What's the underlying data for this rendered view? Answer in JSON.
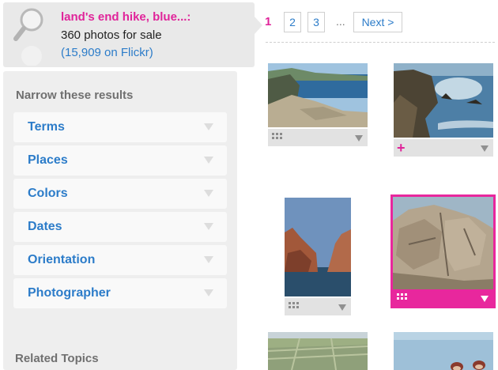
{
  "search": {
    "query": "land's end hike, blue...:",
    "count": "360 photos for sale",
    "flickr": "(15,909 on Flickr)"
  },
  "narrow": {
    "title": "Narrow these results",
    "filters": [
      {
        "label": "Terms"
      },
      {
        "label": "Places"
      },
      {
        "label": "Colors"
      },
      {
        "label": "Dates"
      },
      {
        "label": "Orientation"
      },
      {
        "label": "Photographer"
      }
    ],
    "related_title": "Related Topics"
  },
  "pagination": {
    "current": "1",
    "pages": [
      "2",
      "3"
    ],
    "ellipsis": "...",
    "next": "Next >"
  },
  "photos": [
    {
      "name": "coastal cliffs with rocky beach",
      "action_icon": "grid-icon"
    },
    {
      "name": "sunlit sea with rock islands",
      "action_icon": "plus-icon"
    },
    {
      "name": "sea cliffs portrait",
      "action_icon": "grid-icon"
    },
    {
      "name": "granite rock formation",
      "action_icon": "grid-icon",
      "selected": true
    },
    {
      "name": "green fields and coastline",
      "action_icon": ""
    },
    {
      "name": "feet on rocks by the sea",
      "action_icon": ""
    }
  ],
  "colors": {
    "accent": "#e0249a",
    "link": "#2c7cc9",
    "panel": "#eeeeee"
  }
}
